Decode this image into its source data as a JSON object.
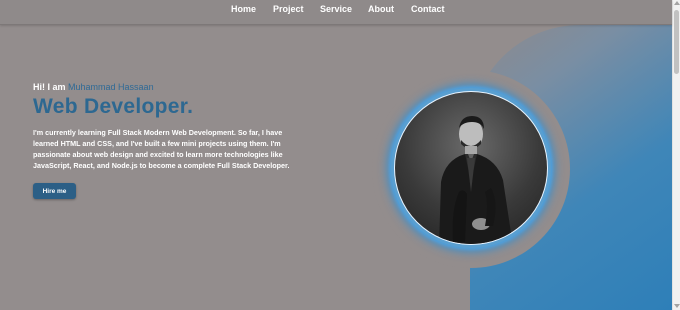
{
  "nav": {
    "items": [
      {
        "label": "Home"
      },
      {
        "label": "Project"
      },
      {
        "label": "Service"
      },
      {
        "label": "About"
      },
      {
        "label": "Contact"
      }
    ]
  },
  "hero": {
    "greeting_prefix": "Hi! I am",
    "name": "Muhammad Hassaan",
    "role": "Web Developer.",
    "intro": "I'm currently learning Full Stack Modern Web Development. So far, I have learned HTML and CSS, and I've built a few mini projects using them. I'm passionate about web design and excited to learn more technologies like JavaScript, React, and Node.js to become a complete Full Stack Developer.",
    "hire_label": "Hire me"
  },
  "colors": {
    "background": "#938d8d",
    "accent": "#2d6891",
    "button": "#2c5f86",
    "glow": "#2f8fd6",
    "panel": "#2e7fb8"
  },
  "photo": {
    "icon": "profile-photo"
  }
}
